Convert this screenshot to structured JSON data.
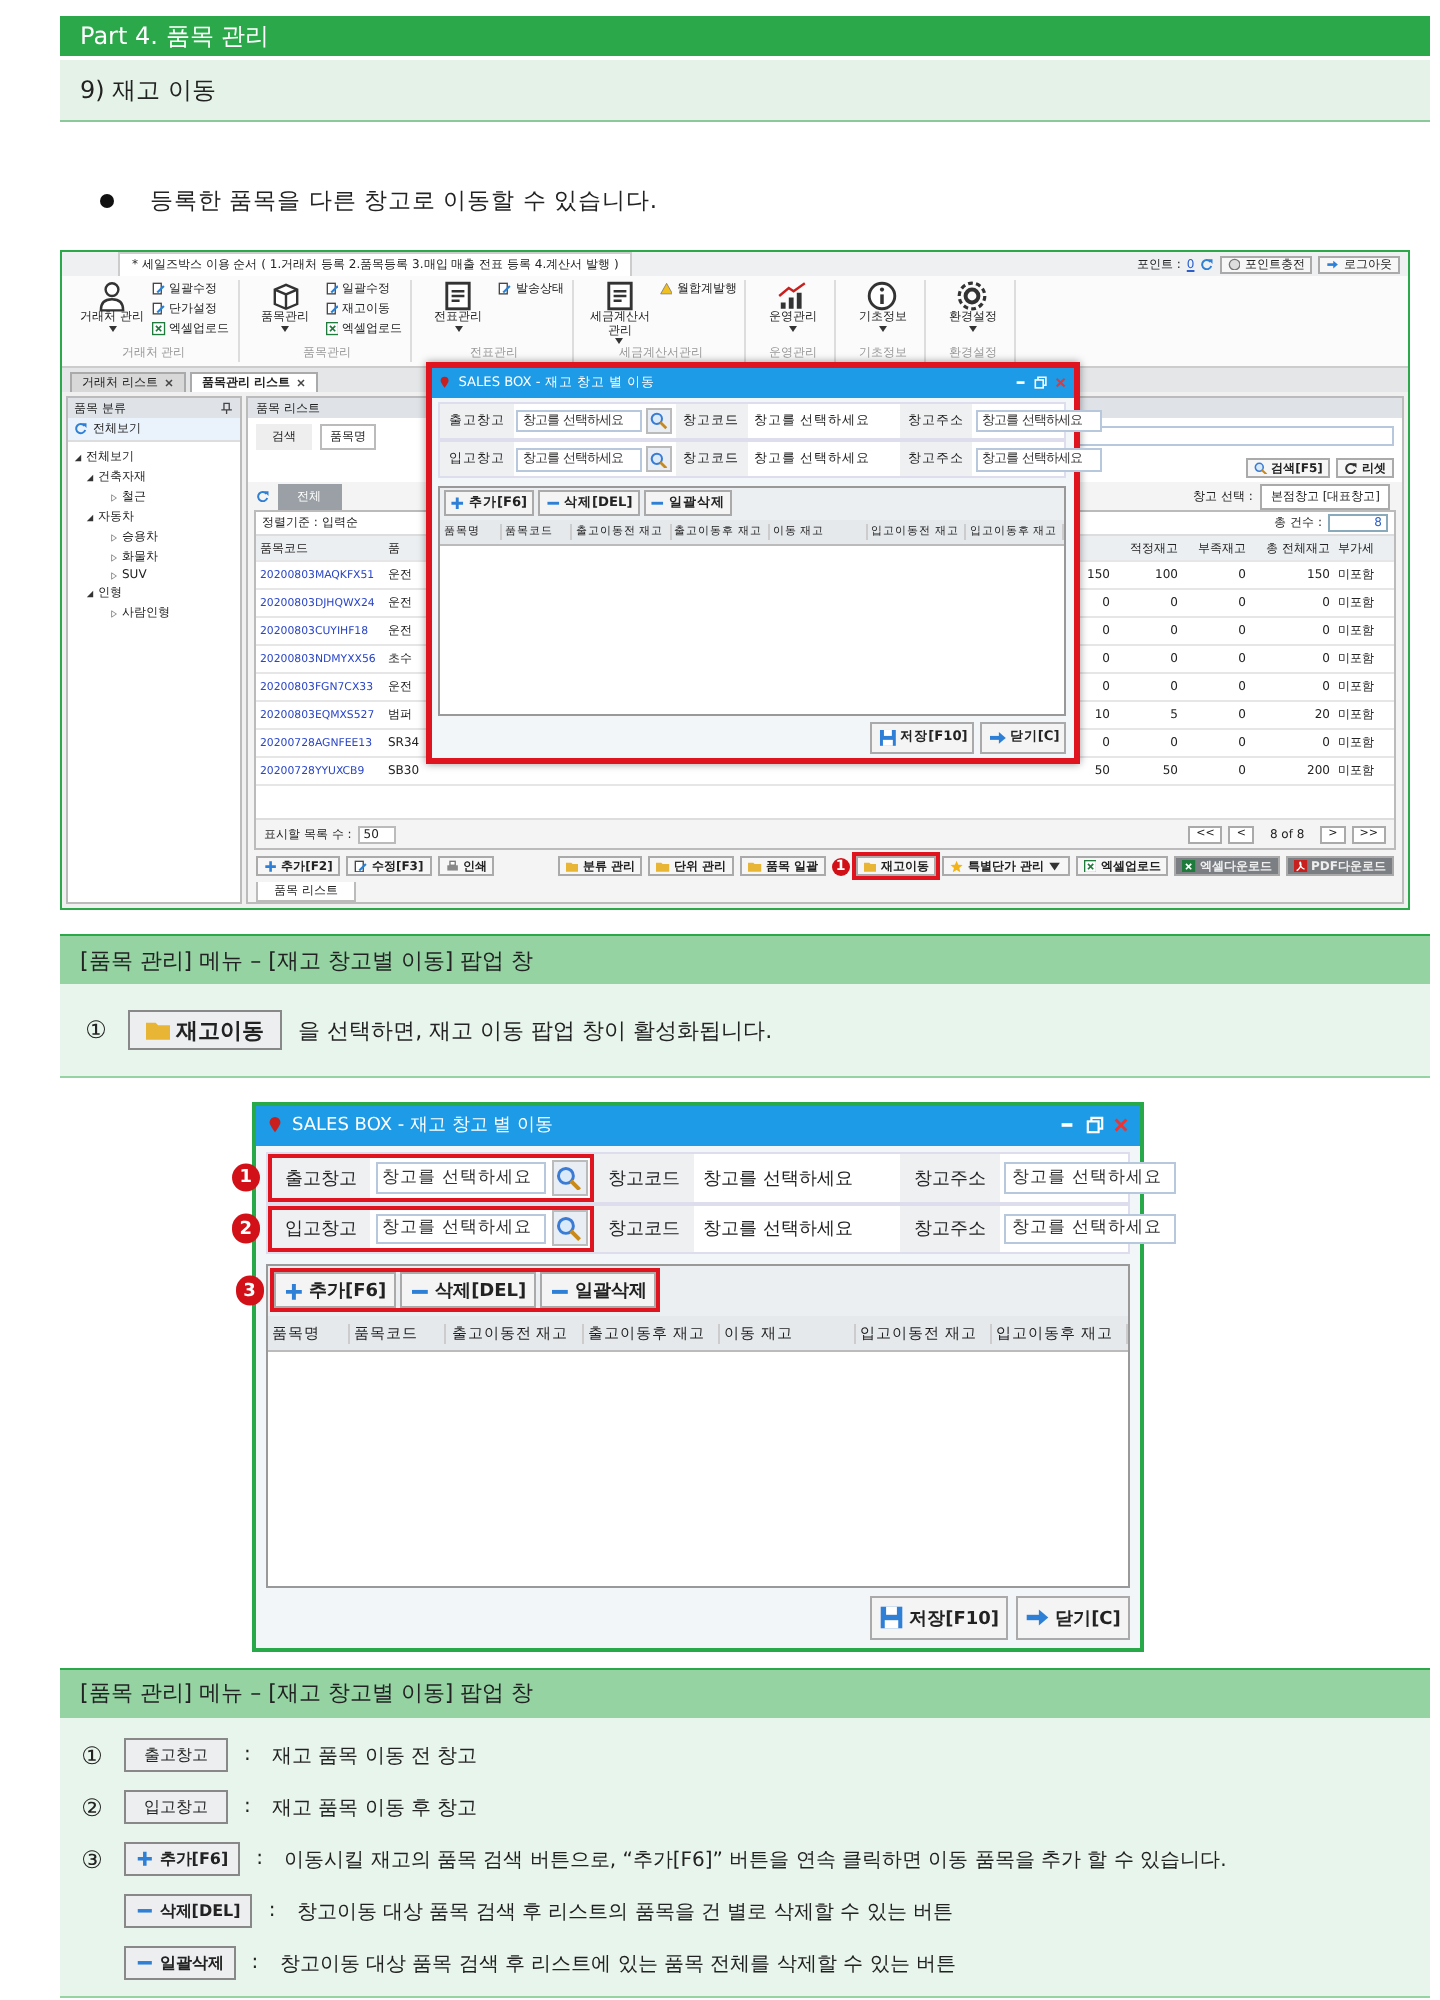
{
  "header": {
    "part_title": "Part 4. 품목 관리",
    "section_title": "9) 재고 이동"
  },
  "intro": "등록한 품목을 다른 창고로 이동할 수 있습니다.",
  "app": {
    "notice_tab": "* 세일즈박스 이용 순서 ( 1.거래처 등록  2.품목등록  3.매입 매출 전표 등록  4.계산서 발행 )",
    "points_label": "포인트 :",
    "points_value": "0",
    "account_buttons": [
      {
        "label": "포인트충전",
        "kind": "coin"
      },
      {
        "label": "로그아웃",
        "kind": "exit"
      }
    ],
    "ribbon": [
      {
        "main": "거래처 관리",
        "dropdown": true,
        "items": [
          {
            "label": "일괄수정",
            "kind": "edit"
          },
          {
            "label": "단가설정",
            "kind": "edit"
          },
          {
            "label": "엑셀업로드",
            "kind": "excel"
          }
        ],
        "group": "거래처 관리"
      },
      {
        "main": "품목관리",
        "dropdown": true,
        "items": [
          {
            "label": "일괄수정",
            "kind": "edit"
          },
          {
            "label": "재고이동",
            "kind": "edit"
          },
          {
            "label": "엑셀업로드",
            "kind": "excel"
          }
        ],
        "group": "품목관리"
      },
      {
        "main": "전표관리",
        "dropdown": true,
        "items": [
          {
            "label": "발송상태",
            "kind": "edit"
          }
        ],
        "group": "전표관리"
      },
      {
        "main": "세금계산서 관리",
        "dropdown": true,
        "items": [
          {
            "label": "월합계발행",
            "kind": "warn"
          }
        ],
        "group": "세금계산서관리"
      },
      {
        "main": "운영관리",
        "dropdown": true,
        "group": "운영관리"
      },
      {
        "main": "기초정보",
        "dropdown": true,
        "group": "기초정보"
      },
      {
        "main": "환경설정",
        "dropdown": true,
        "group": "환경설정"
      }
    ],
    "doc_tabs": [
      {
        "label": "거래처 리스트",
        "selected": false
      },
      {
        "label": "품목관리 리스트",
        "selected": true
      }
    ],
    "sidebar": {
      "title": "품목 분류",
      "all": "전체보기",
      "tree": [
        {
          "label": "전체보기",
          "expanded": true,
          "children": [
            {
              "label": "건축자재",
              "expanded": true,
              "children": [
                {
                  "label": "철근",
                  "expanded": false
                }
              ]
            },
            {
              "label": "자동차",
              "expanded": true,
              "children": [
                {
                  "label": "승용차",
                  "expanded": false
                },
                {
                  "label": "화물차",
                  "expanded": false
                },
                {
                  "label": "SUV",
                  "expanded": false
                }
              ]
            },
            {
              "label": "인형",
              "expanded": true,
              "children": [
                {
                  "label": "사람인형",
                  "expanded": false
                }
              ]
            }
          ]
        }
      ]
    },
    "list": {
      "title": "품목 리스트",
      "search_label": "검색",
      "search_field": "품목명",
      "buttons": [
        {
          "label": "검색[F5]",
          "kind": "search"
        },
        {
          "label": "리셋",
          "kind": "reset"
        }
      ],
      "filter_tab": "전체",
      "warehouse_label": "창고 선택 :",
      "warehouse_value": "본점창고 [대표창고]",
      "sort_label": "정렬기준 : 입력순",
      "count_label": "총 건수 :",
      "count_value": "8",
      "headers": {
        "code": "품목코드",
        "name": "품",
        "proper": "적정재고",
        "shortage": "부족재고",
        "total": "총 전체재고",
        "vat": "부가세"
      },
      "rows": [
        {
          "code": "20200803MAQKFX51",
          "name": "운전",
          "column_3": "150",
          "proper": "100",
          "shortage": "0",
          "total": "150",
          "vat": "미포함"
        },
        {
          "code": "20200803DJHQWX24",
          "name": "운전",
          "column_3": "0",
          "proper": "0",
          "shortage": "0",
          "total": "0",
          "vat": "미포함"
        },
        {
          "code": "20200803CUYIHF18",
          "name": "운전",
          "column_3": "0",
          "proper": "0",
          "shortage": "0",
          "total": "0",
          "vat": "미포함"
        },
        {
          "code": "20200803NDMYXX56",
          "name": "초수",
          "column_3": "0",
          "proper": "0",
          "shortage": "0",
          "total": "0",
          "vat": "미포함"
        },
        {
          "code": "20200803FGN7CX33",
          "name": "운전",
          "column_3": "0",
          "proper": "0",
          "shortage": "0",
          "total": "0",
          "vat": "미포함"
        },
        {
          "code": "20200803EQMXS527",
          "name": "범퍼",
          "column_3": "10",
          "proper": "5",
          "shortage": "0",
          "total": "20",
          "vat": "미포함"
        },
        {
          "code": "20200728AGNFEE13",
          "name": "SR34",
          "column_3": "0",
          "proper": "0",
          "shortage": "0",
          "total": "0",
          "vat": "미포함"
        },
        {
          "code": "20200728YYUXCB9",
          "name": "SB30",
          "column_3": "50",
          "proper": "50",
          "shortage": "0",
          "total": "200",
          "vat": "미포함"
        }
      ],
      "page_size_label": "표시할 목록 수 :",
      "page_size": "50",
      "pager": {
        "first": "<<",
        "prev": "<",
        "status": "8 of 8",
        "next": ">",
        "last": ">>"
      },
      "left_actions": [
        {
          "label": "추가[F2]",
          "kind": "add"
        },
        {
          "label": "수정[F3]",
          "kind": "edit"
        },
        {
          "label": "인쇄",
          "kind": "print"
        }
      ],
      "right_actions": [
        {
          "label": "분류 관리",
          "kind": "folder",
          "highlighted": false
        },
        {
          "label": "단위 관리",
          "kind": "folder",
          "highlighted": false
        },
        {
          "label": "품목 일괄",
          "kind": "folder",
          "highlighted": false
        },
        {
          "label": "재고이동",
          "kind": "folder",
          "highlighted": true,
          "marker": "1"
        },
        {
          "label": "특별단가 관리",
          "kind": "star",
          "highlighted": false,
          "dropdown": true
        },
        {
          "label": "엑셀업로드",
          "kind": "excel",
          "highlighted": false
        },
        {
          "label": "엑셀다운로드",
          "kind": "excel-dark",
          "highlighted": false
        },
        {
          "label": "PDF다운로드",
          "kind": "pdf",
          "highlighted": false
        }
      ],
      "bottom_tab": "품목 리스트"
    },
    "popup": {
      "title": "SALES BOX - 재고 창고 별 이동",
      "highlighted": true,
      "warehouses": [
        {
          "label": "출고창고",
          "placeholder": "창고를 선택하세요",
          "code_label": "창고코드",
          "code_value": "창고를 선택하세요",
          "address_label": "창고주소",
          "address_placeholder": "창고를 선택하세요"
        },
        {
          "label": "입고창고",
          "placeholder": "창고를 선택하세요",
          "code_label": "창고코드",
          "code_value": "창고를 선택하세요",
          "address_label": "창고주소",
          "address_placeholder": "창고를 선택하세요"
        }
      ],
      "actions": [
        {
          "label": "추가[F6]",
          "kind": "add"
        },
        {
          "label": "삭제[DEL]",
          "kind": "remove"
        },
        {
          "label": "일괄삭제",
          "kind": "remove"
        }
      ],
      "columns": [
        "품목명",
        "품목코드",
        "출고이동전 재고",
        "출고이동후 재고",
        "이동 재고",
        "입고이동전 재고",
        "입고이동후 재고"
      ],
      "footer": [
        {
          "label": "저장[F10]",
          "kind": "save"
        },
        {
          "label": "닫기[C]",
          "kind": "exit"
        }
      ]
    }
  },
  "caption_1": "[품목 관리] 메뉴 – [재고 창고별 이동] 팝업 창",
  "step": {
    "number": "①",
    "button": "재고이동",
    "text": "을 선택하면,  재고 이동 팝업 창이 활성화됩니다."
  },
  "popup_large": {
    "title": "SALES BOX - 재고 창고 별 이동",
    "highlighted": false,
    "warehouses": [
      {
        "label": "출고창고",
        "placeholder": "창고를 선택하세요",
        "code_label": "창고코드",
        "code_value": "창고를 선택하세요",
        "address_label": "창고주소",
        "address_placeholder": "창고를 선택하세요",
        "marker": "1"
      },
      {
        "label": "입고창고",
        "placeholder": "창고를 선택하세요",
        "code_label": "창고코드",
        "code_value": "창고를 선택하세요",
        "address_label": "창고주소",
        "address_placeholder": "창고를 선택하세요",
        "marker": "2"
      }
    ],
    "actions": [
      {
        "label": "추가[F6]",
        "kind": "add"
      },
      {
        "label": "삭제[DEL]",
        "kind": "remove"
      },
      {
        "label": "일괄삭제",
        "kind": "remove"
      }
    ],
    "actions_marker": "3",
    "columns": [
      "품목명",
      "품목코드",
      "출고이동전 재고",
      "출고이동후 재고",
      "이동 재고",
      "입고이동전 재고",
      "입고이동후 재고"
    ],
    "footer": [
      {
        "label": "저장[F10]",
        "kind": "save"
      },
      {
        "label": "닫기[C]",
        "kind": "exit"
      }
    ]
  },
  "caption_2": "[품목 관리] 메뉴 – [재고 창고별 이동] 팝업 창",
  "legend": [
    {
      "number": "①",
      "kind": "plain",
      "button": "출고창고",
      "separator": ":",
      "text": "재고 품목 이동 전 창고"
    },
    {
      "number": "②",
      "kind": "plain",
      "button": "입고창고",
      "separator": ":",
      "text": "재고 품목 이동 후 창고"
    },
    {
      "number": "③",
      "kind": "add",
      "button": "추가[F6]",
      "separator": ":",
      "text": "이동시킬 재고의 품목 검색 버튼으로, “추가[F6]” 버튼을 연속 클릭하면 이동 품목을 추가 할 수 있습니다."
    },
    {
      "kind": "remove",
      "button": "삭제[DEL]",
      "separator": ":",
      "text": "창고이동 대상 품목 검색 후 리스트의 품목을 건 별로 삭제할 수 있는 버튼"
    },
    {
      "kind": "remove",
      "button": "일괄삭제",
      "separator": ":",
      "text": "창고이동 대상 품목 검색 후 리스트에 있는 품목 전체를 삭제할 수 있는 버튼"
    }
  ]
}
